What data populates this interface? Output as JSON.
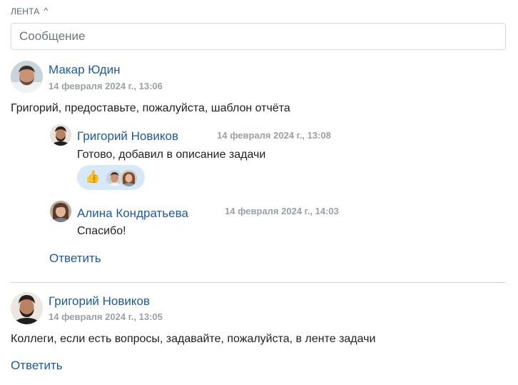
{
  "feed": {
    "title": "ЛЕНТА",
    "message_placeholder": "Сообщение"
  },
  "posts": [
    {
      "author": "Макар Юдин",
      "date": "14 февраля 2024 г., 13:06",
      "text": "Григорий, предоставьте, пожалуйста, шаблон отчёта",
      "comments": [
        {
          "author": "Григорий Новиков",
          "date": "14 февраля 2024 г., 13:08",
          "text": "Готово, добавил в описание задачи",
          "reaction": "👍"
        },
        {
          "author": "Алина Кондратьева",
          "date": "14 февраля 2024 г., 14:03",
          "text": "Спасибо!"
        }
      ],
      "reply_label": "Ответить"
    },
    {
      "author": "Григорий Новиков",
      "date": "14 февраля 2024 г., 13:05",
      "text": "Коллеги, если есть вопросы, задавайте, пожалуйста, в ленте задачи",
      "reply_label": "Ответить"
    }
  ]
}
